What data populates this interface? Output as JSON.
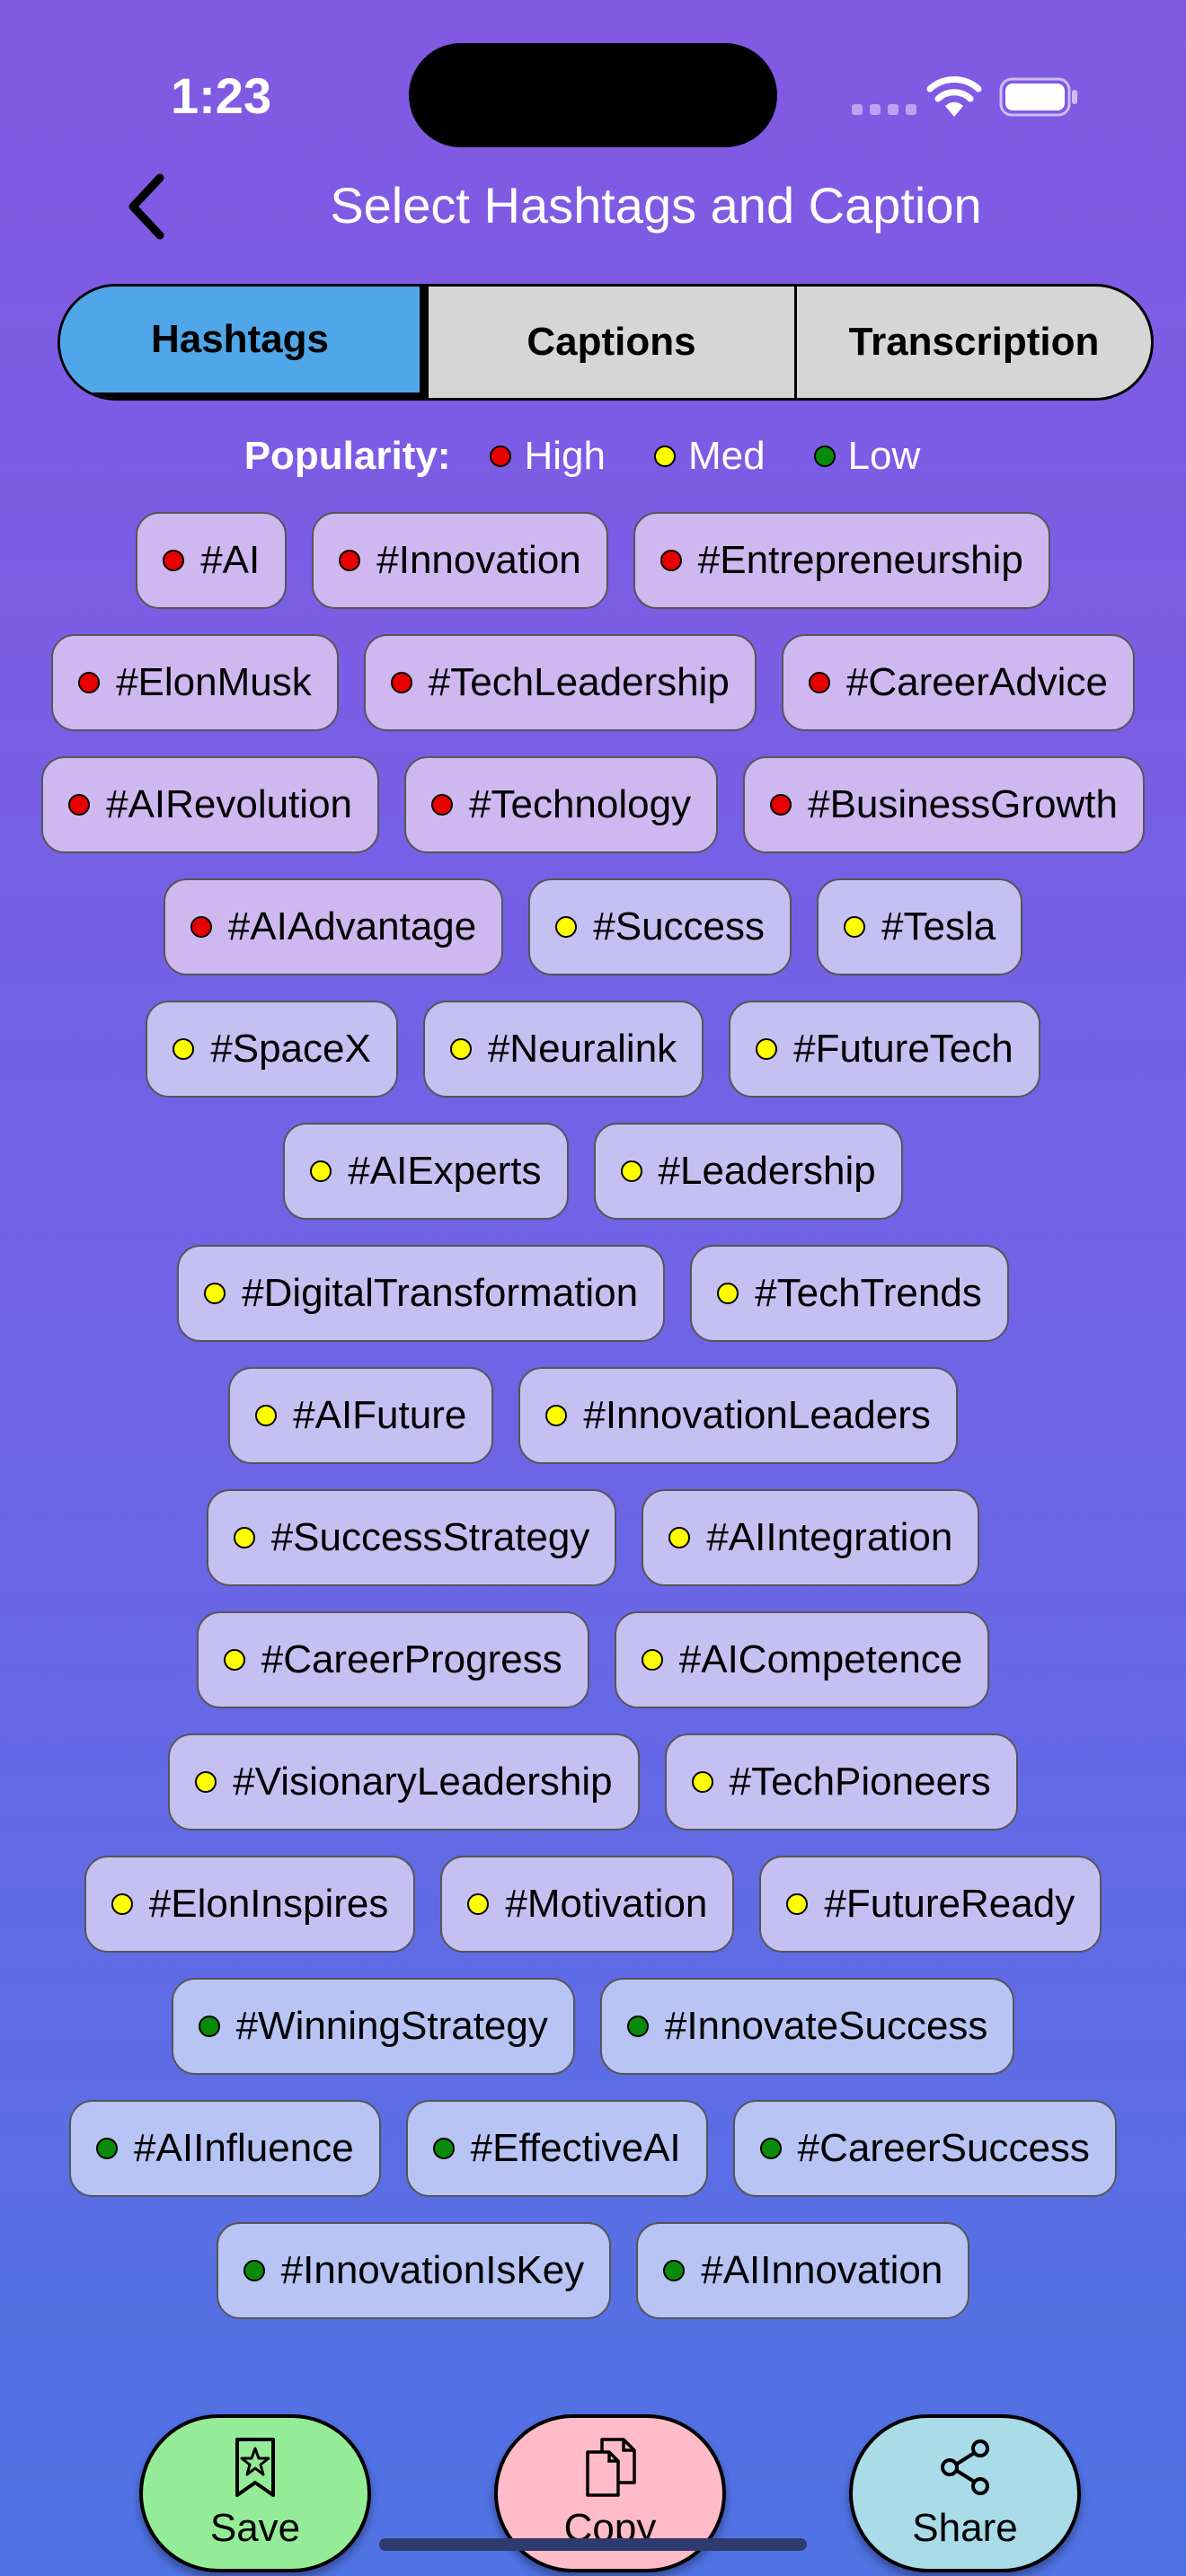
{
  "status_bar": {
    "time": "1:23"
  },
  "nav": {
    "title": "Select Hashtags and Caption"
  },
  "tabs": [
    {
      "label": "Hashtags",
      "selected": true
    },
    {
      "label": "Captions",
      "selected": false
    },
    {
      "label": "Transcription",
      "selected": false
    }
  ],
  "legend": {
    "label": "Popularity:",
    "items": [
      {
        "label": "High",
        "color": "#e80000"
      },
      {
        "label": "Med",
        "color": "#ffff00"
      },
      {
        "label": "Low",
        "color": "#0a8a0a"
      }
    ]
  },
  "colors": {
    "high": "#e80000",
    "med": "#ffff00",
    "low": "#0a8a0a"
  },
  "hashtags": [
    {
      "tag": "#AI",
      "popularity": "high"
    },
    {
      "tag": "#Innovation",
      "popularity": "high"
    },
    {
      "tag": "#Entrepreneurship",
      "popularity": "high"
    },
    {
      "tag": "#ElonMusk",
      "popularity": "high"
    },
    {
      "tag": "#TechLeadership",
      "popularity": "high"
    },
    {
      "tag": "#CareerAdvice",
      "popularity": "high"
    },
    {
      "tag": "#AIRevolution",
      "popularity": "high"
    },
    {
      "tag": "#Technology",
      "popularity": "high"
    },
    {
      "tag": "#BusinessGrowth",
      "popularity": "high"
    },
    {
      "tag": "#AIAdvantage",
      "popularity": "high"
    },
    {
      "tag": "#Success",
      "popularity": "med"
    },
    {
      "tag": "#Tesla",
      "popularity": "med"
    },
    {
      "tag": "#SpaceX",
      "popularity": "med"
    },
    {
      "tag": "#Neuralink",
      "popularity": "med"
    },
    {
      "tag": "#FutureTech",
      "popularity": "med"
    },
    {
      "tag": "#AIExperts",
      "popularity": "med"
    },
    {
      "tag": "#Leadership",
      "popularity": "med"
    },
    {
      "tag": "#DigitalTransformation",
      "popularity": "med"
    },
    {
      "tag": "#TechTrends",
      "popularity": "med"
    },
    {
      "tag": "#AIFuture",
      "popularity": "med"
    },
    {
      "tag": "#InnovationLeaders",
      "popularity": "med"
    },
    {
      "tag": "#SuccessStrategy",
      "popularity": "med"
    },
    {
      "tag": "#AIIntegration",
      "popularity": "med"
    },
    {
      "tag": "#CareerProgress",
      "popularity": "med"
    },
    {
      "tag": "#AICompetence",
      "popularity": "med"
    },
    {
      "tag": "#VisionaryLeadership",
      "popularity": "med"
    },
    {
      "tag": "#TechPioneers",
      "popularity": "med"
    },
    {
      "tag": "#ElonInspires",
      "popularity": "med"
    },
    {
      "tag": "#Motivation",
      "popularity": "med"
    },
    {
      "tag": "#FutureReady",
      "popularity": "med"
    },
    {
      "tag": "#WinningStrategy",
      "popularity": "low"
    },
    {
      "tag": "#InnovateSuccess",
      "popularity": "low"
    },
    {
      "tag": "#AIInfluence",
      "popularity": "low"
    },
    {
      "tag": "#EffectiveAI",
      "popularity": "low"
    },
    {
      "tag": "#CareerSuccess",
      "popularity": "low"
    },
    {
      "tag": "#InnovationIsKey",
      "popularity": "low"
    },
    {
      "tag": "#AIInnovation",
      "popularity": "low"
    }
  ],
  "actions": {
    "save": {
      "label": "Save",
      "color": "#95ec98"
    },
    "copy": {
      "label": "Copy",
      "color": "#ffbcc8"
    },
    "share": {
      "label": "Share",
      "color": "#a9dbe8"
    }
  }
}
